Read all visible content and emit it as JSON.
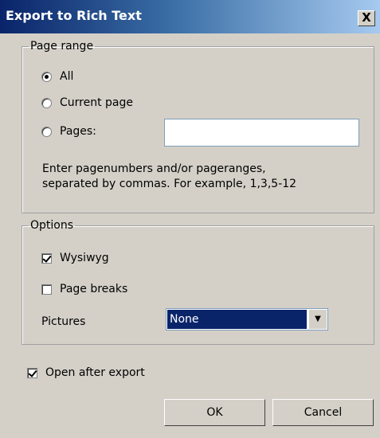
{
  "window": {
    "title": "Export to Rich Text",
    "close_label": "X"
  },
  "page_range": {
    "legend": "Page range",
    "options": [
      {
        "label": "All",
        "selected": true
      },
      {
        "label": "Current page",
        "selected": false
      },
      {
        "label": "Pages:",
        "selected": false
      }
    ],
    "pages_value": "",
    "hint_line1": "Enter pagenumbers and/or pageranges,",
    "hint_line2": "separated by commas. For example, 1,3,5-12"
  },
  "options": {
    "legend": "Options",
    "wysiwyg": {
      "label": "Wysiwyg",
      "checked": true
    },
    "page_breaks": {
      "label": "Page breaks",
      "checked": false
    },
    "pictures": {
      "label": "Pictures",
      "value": "None"
    }
  },
  "open_after_export": {
    "label": "Open after export",
    "checked": true
  },
  "buttons": {
    "ok": "OK",
    "cancel": "Cancel"
  }
}
